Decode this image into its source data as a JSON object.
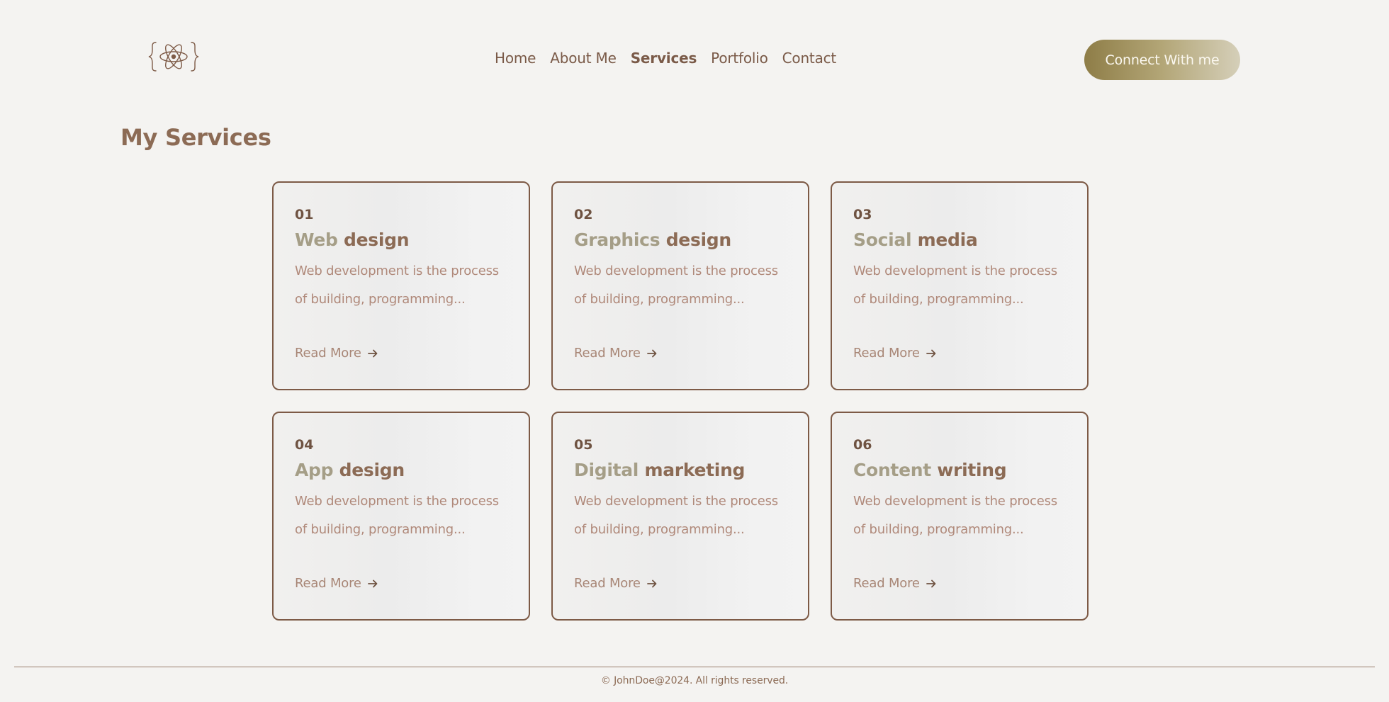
{
  "header": {
    "logo_icon": "react-atom-in-braces-icon",
    "nav": [
      {
        "label": "Home",
        "active": false
      },
      {
        "label": "About Me",
        "active": false
      },
      {
        "label": "Services",
        "active": true
      },
      {
        "label": "Portfolio",
        "active": false
      },
      {
        "label": "Contact",
        "active": false
      }
    ],
    "cta_label": "Connect With me"
  },
  "main": {
    "title": "My Services",
    "services": [
      {
        "num": "01",
        "title_a": "Web",
        "title_b": "design",
        "desc": "Web development is the process of building, programming...",
        "link": "Read More"
      },
      {
        "num": "02",
        "title_a": "Graphics",
        "title_b": "design",
        "desc": "Web development is the process of building, programming...",
        "link": "Read More"
      },
      {
        "num": "03",
        "title_a": "Social",
        "title_b": "media",
        "desc": "Web development is the process of building, programming...",
        "link": "Read More"
      },
      {
        "num": "04",
        "title_a": "App",
        "title_b": "design",
        "desc": "Web development is the process of building, programming...",
        "link": "Read More"
      },
      {
        "num": "05",
        "title_a": "Digital",
        "title_b": "marketing",
        "desc": "Web development is the process of building, programming...",
        "link": "Read More"
      },
      {
        "num": "06",
        "title_a": "Content",
        "title_b": "writing",
        "desc": "Web development is the process of building, programming...",
        "link": "Read More"
      }
    ]
  },
  "footer": {
    "text": "© JohnDoe@2024. All rights reserved."
  },
  "colors": {
    "background": "#f4f3f1",
    "accent_brown": "#8c6b55",
    "title_muted": "#a59e87",
    "cta_gradient_start": "#8e7d47",
    "cta_gradient_end": "#d5cfb9"
  }
}
